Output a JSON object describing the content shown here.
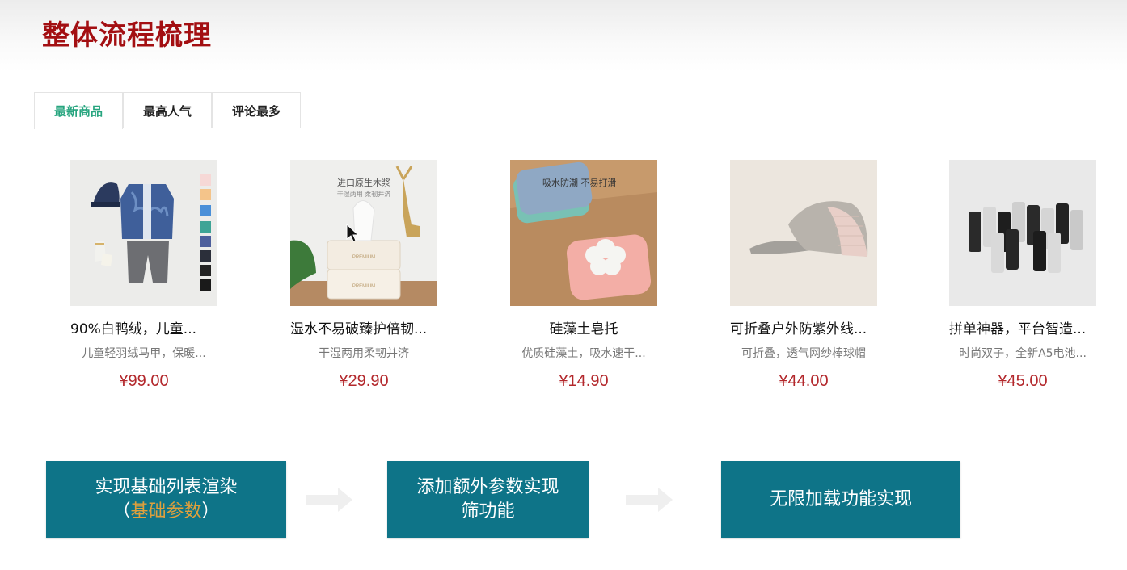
{
  "slide": {
    "title": "整体流程梳理"
  },
  "tabs": [
    {
      "label": "最新商品",
      "active": true
    },
    {
      "label": "最高人气",
      "active": false
    },
    {
      "label": "评论最多",
      "active": false
    }
  ],
  "products": [
    {
      "name": "90%白鸭绒，儿童...",
      "desc": "儿童轻羽绒马甲，保暖...",
      "price": "¥99.00",
      "image": "kids-clothing-photo"
    },
    {
      "name": "湿水不易破臻护倍韧...",
      "desc": "干湿两用柔韧并济",
      "price": "¥29.90",
      "image": "tissue-pack-photo",
      "image_text": [
        "进口原生木浆",
        "干湿两用 柔韧并济"
      ]
    },
    {
      "name": "硅藻土皂托",
      "desc": "优质硅藻土，吸水速干...",
      "price": "¥14.90",
      "image": "soap-dish-photo",
      "image_text": [
        "吸水防潮 不易打滑"
      ]
    },
    {
      "name": "可折叠户外防紫外线...",
      "desc": "可折叠，透气网纱棒球帽",
      "price": "¥44.00",
      "image": "baseball-cap-photo"
    },
    {
      "name": "拼单神器，平台智造...",
      "desc": "时尚双子，全新A5电池...",
      "price": "¥45.00",
      "image": "batteries-photo"
    }
  ],
  "flow": {
    "step1": {
      "line1": "实现基础列表渲染",
      "line2_open": "（",
      "line2_highlight": "基础参数",
      "line2_close": "）"
    },
    "step2": {
      "line1": "添加额外参数实现",
      "line2": "筛功能"
    },
    "step3": {
      "line1": "无限加载功能实现"
    },
    "colors": {
      "box": "#0e7488",
      "highlight": "#e0a03c",
      "title": "#a30f12",
      "price": "#b3282c",
      "active_tab": "#27a57f"
    }
  }
}
